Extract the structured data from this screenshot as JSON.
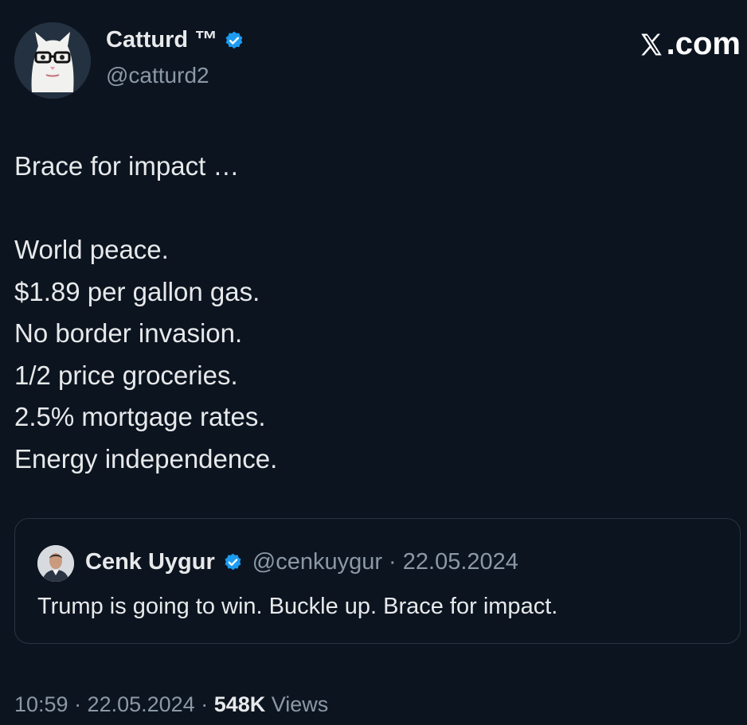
{
  "brand": {
    "text": ".com",
    "icon": "x-logo-icon"
  },
  "author": {
    "name": "Catturd ™",
    "handle": "@catturd2",
    "verified_icon": "verified-badge-icon",
    "avatar_icon": "cat-with-glasses-avatar"
  },
  "tweet": {
    "lines": [
      "Brace for impact …",
      "",
      "World peace.",
      "$1.89 per gallon gas.",
      "No border invasion.",
      "1/2 price groceries.",
      "2.5% mortgage rates.",
      "Energy independence."
    ]
  },
  "quoted": {
    "name": "Cenk Uygur",
    "meta": "@cenkuygur · 22.05.2024",
    "text": "Trump is going to win. Buckle up. Brace for impact.",
    "verified_icon": "verified-badge-icon",
    "avatar_icon": "person-avatar"
  },
  "footer": {
    "prefix": "10:59 · 22.05.2024 · ",
    "views_count": "548K",
    "views_label": " Views"
  },
  "colors": {
    "background": "#0c1420",
    "text": "#e7e9ea",
    "muted": "#8b98a5",
    "verified": "#1d9bf0",
    "border": "#2a3440"
  }
}
